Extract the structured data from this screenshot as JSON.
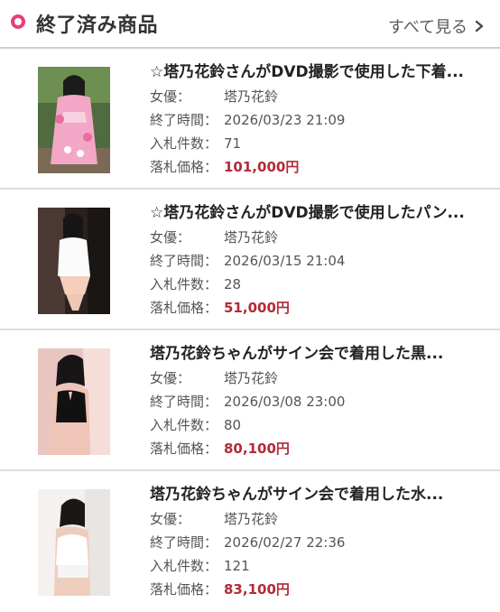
{
  "header": {
    "title": "終了済み商品",
    "see_all_label": "すべて見る",
    "accent_color": "#e63f78"
  },
  "labels": {
    "actress": "女優：",
    "end_time": "終了時間：",
    "bid_count": "入札件数：",
    "final_price": "落札価格："
  },
  "items": [
    {
      "title": "☆塔乃花鈴さんがDVD撮影で使用した下着...",
      "actress": "塔乃花鈴",
      "end_time": "2026/03/23 21:09",
      "bid_count": "71",
      "final_price": "101,000円",
      "thumbnail": "kimono-photo"
    },
    {
      "title": "☆塔乃花鈴さんがDVD撮影で使用したパン...",
      "actress": "塔乃花鈴",
      "end_time": "2026/03/15 21:04",
      "bid_count": "28",
      "final_price": "51,000円",
      "thumbnail": "white-shirt-photo"
    },
    {
      "title": "塔乃花鈴ちゃんがサイン会で着用した黒...",
      "actress": "塔乃花鈴",
      "end_time": "2026/03/08 23:00",
      "bid_count": "80",
      "final_price": "80,100円",
      "thumbnail": "black-top-photo"
    },
    {
      "title": "塔乃花鈴ちゃんがサイン会で着用した水...",
      "actress": "塔乃花鈴",
      "end_time": "2026/02/27 22:36",
      "bid_count": "121",
      "final_price": "83,100円",
      "thumbnail": "white-top-photo"
    }
  ],
  "colors": {
    "price": "#b22b38",
    "divider": "#dedede"
  }
}
